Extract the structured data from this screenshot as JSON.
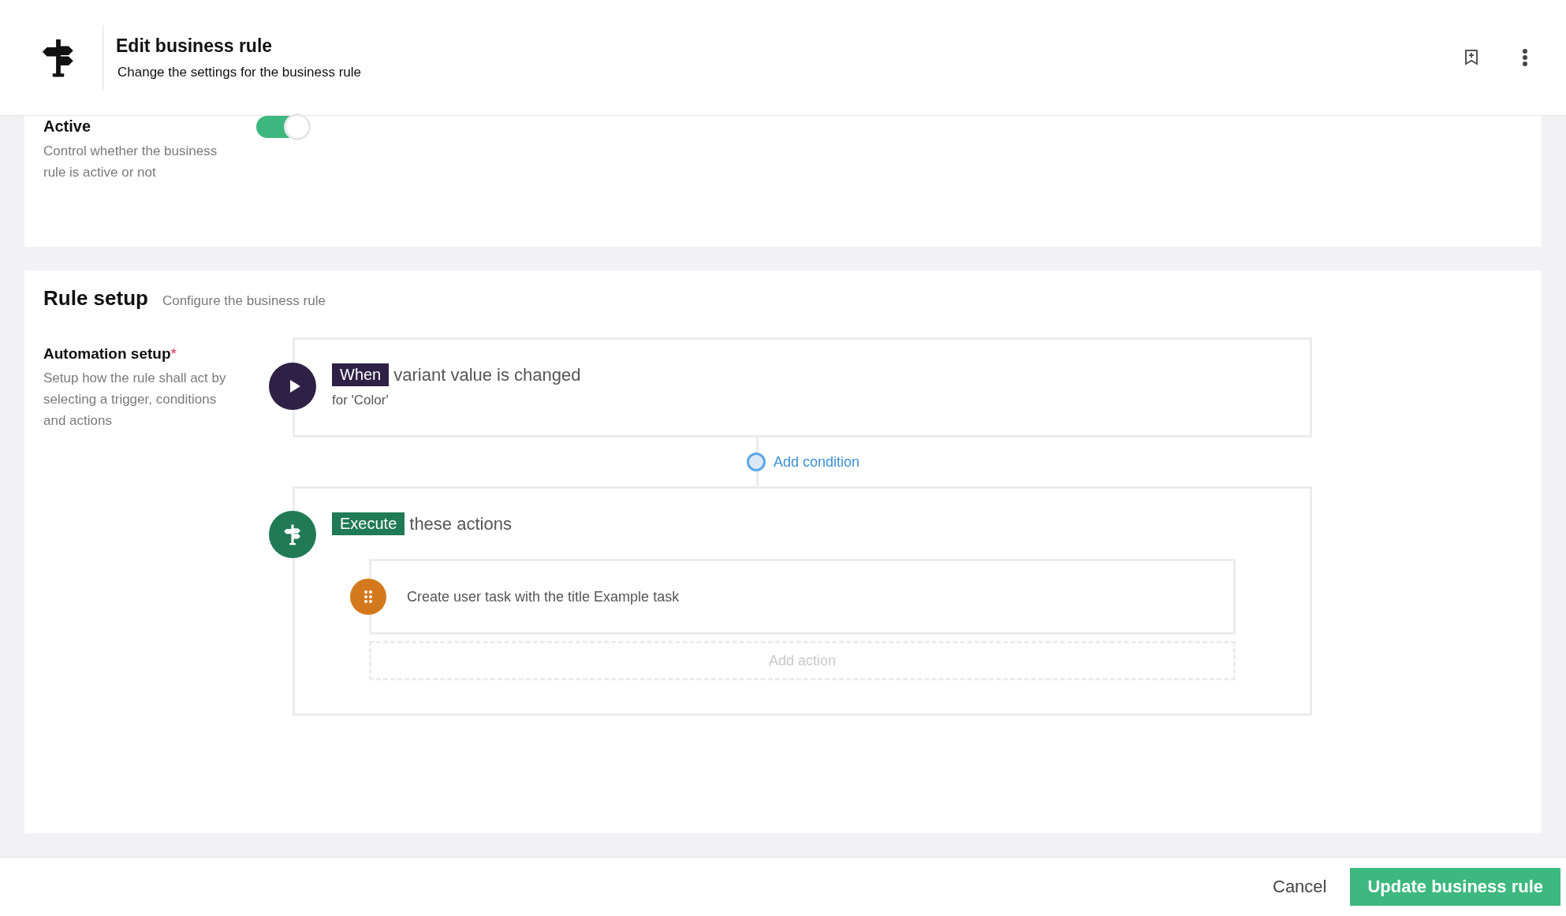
{
  "header": {
    "title": "Edit business rule",
    "subtitle": "Change the settings for the business rule"
  },
  "status_section": {
    "label": "Active",
    "description": "Control whether the business rule is active or not",
    "toggle": {
      "on": true
    }
  },
  "rule_setup": {
    "title": "Rule setup",
    "subtitle": "Configure the business rule",
    "field": {
      "label": "Automation setup",
      "required_mark": "*",
      "description": "Setup how the rule shall act by selecting a trigger, conditions and actions"
    },
    "trigger": {
      "tag": "When",
      "text": "variant value is changed",
      "detail": "for 'Color'"
    },
    "add_condition": "Add condition",
    "action_block": {
      "tag": "Execute",
      "text": "these actions",
      "actions": [
        {
          "text": "Create user task with the title Example task"
        }
      ],
      "add_action": "Add action"
    }
  },
  "footer": {
    "buttons": [
      {
        "label": "Cancel",
        "kind": "secondary"
      },
      {
        "label": "Update business rule",
        "kind": "primary"
      }
    ]
  }
}
